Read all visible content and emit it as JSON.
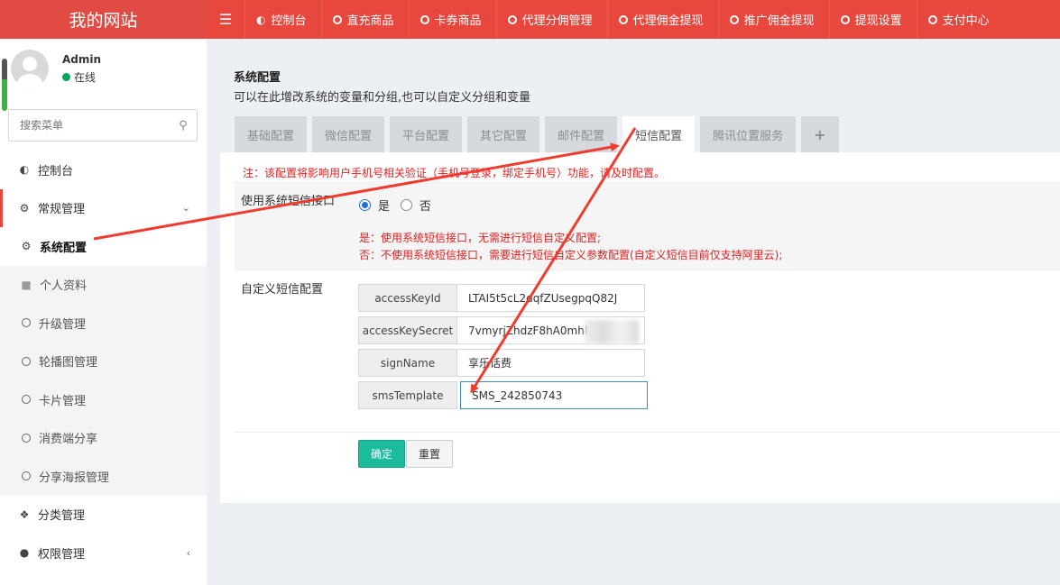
{
  "header": {
    "site_title": "我的网站",
    "nav": [
      {
        "label": "控制台",
        "icon": "dashboard-icon"
      },
      {
        "label": "直充商品",
        "icon": "circle-icon"
      },
      {
        "label": "卡券商品",
        "icon": "circle-icon"
      },
      {
        "label": "代理分佣管理",
        "icon": "circle-icon"
      },
      {
        "label": "代理佣金提现",
        "icon": "circle-icon"
      },
      {
        "label": "推广佣金提现",
        "icon": "circle-icon"
      },
      {
        "label": "提现设置",
        "icon": "circle-icon"
      },
      {
        "label": "支付中心",
        "icon": "circle-icon"
      }
    ]
  },
  "sidebar": {
    "user_name": "Admin",
    "user_status": "在线",
    "search_placeholder": "搜索菜单",
    "items": [
      {
        "label": "控制台"
      },
      {
        "label": "常规管理"
      },
      {
        "label": "系统配置"
      },
      {
        "label": "个人资料"
      },
      {
        "label": "升级管理"
      },
      {
        "label": "轮播图管理"
      },
      {
        "label": "卡片管理"
      },
      {
        "label": "消费端分享"
      },
      {
        "label": "分享海报管理"
      },
      {
        "label": "分类管理"
      },
      {
        "label": "权限管理"
      }
    ]
  },
  "main": {
    "title": "系统配置",
    "subtitle": "可以在此增改系统的变量和分组,也可以自定义分组和变量",
    "tabs": [
      {
        "label": "基础配置"
      },
      {
        "label": "微信配置"
      },
      {
        "label": "平台配置"
      },
      {
        "label": "其它配置"
      },
      {
        "label": "邮件配置"
      },
      {
        "label": "短信配置"
      },
      {
        "label": "腾讯位置服务"
      },
      {
        "label": "+"
      }
    ],
    "active_tab": "短信配置",
    "notice": "注：该配置将影响用户手机号相关验证（手机号登录，绑定手机号）功能，请及时配置。",
    "use_system_sms_label": "使用系统短信接口",
    "radio_yes": "是",
    "radio_no": "否",
    "hint_yes": "是：使用系统短信接口，无需进行短信自定义配置;",
    "hint_no": "否：不使用系统短信接口，需要进行短信自定义参数配置(自定义短信目前仅支持阿里云);",
    "custom_sms_label": "自定义短信配置",
    "fields": [
      {
        "key": "accessKeyId",
        "value": "LTAI5t5cL2dqfZUsegpqQ82J"
      },
      {
        "key": "accessKeySecret",
        "value": "7vmyrjZhdzF8hA0mhPqR"
      },
      {
        "key": "signName",
        "value": "享乐话费"
      },
      {
        "key": "smsTemplate",
        "value": "SMS_242850743"
      }
    ],
    "submit_label": "确定",
    "reset_label": "重置"
  },
  "colors": {
    "header": "#e8473e",
    "accent_green": "#1abc9c",
    "notice_red": "#e02020",
    "arrow_red": "#f03c2e"
  }
}
